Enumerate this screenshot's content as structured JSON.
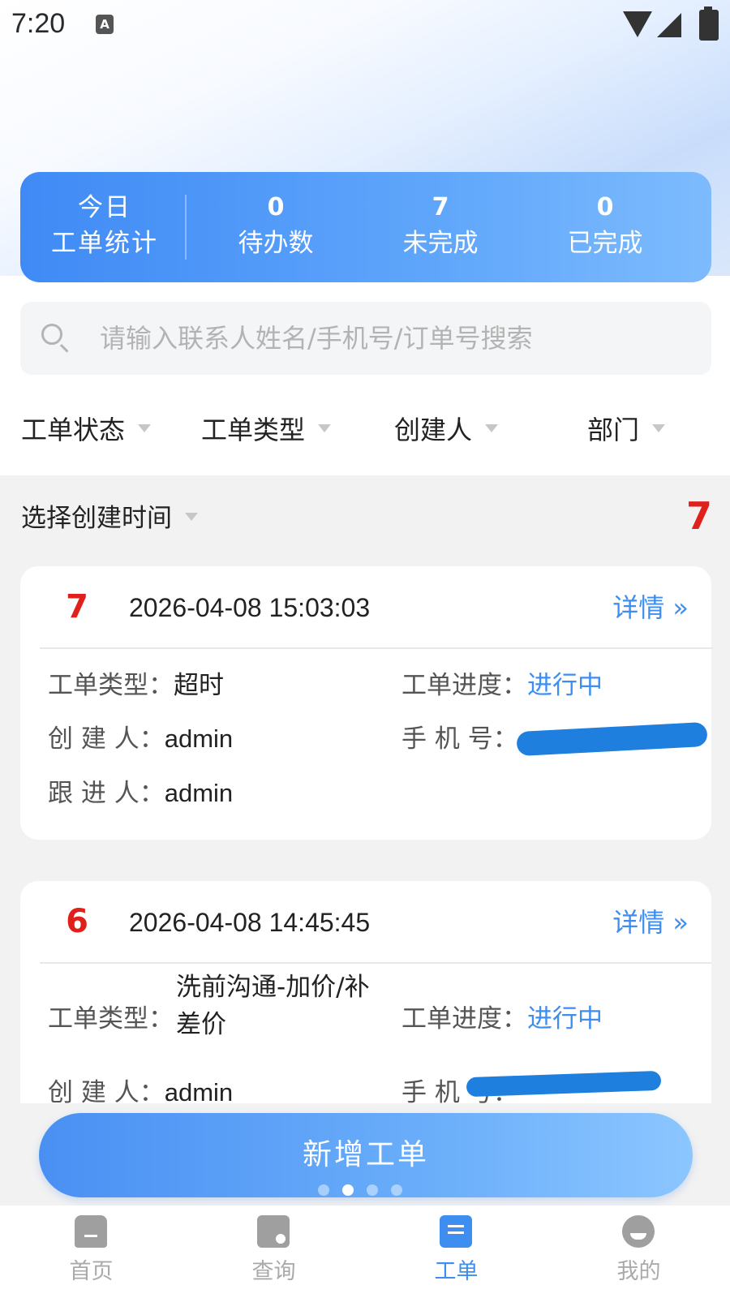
{
  "status_bar": {
    "time": "7:20",
    "notification_letter": "A"
  },
  "stats": {
    "title_line1": "今日",
    "title_line2": "工单统计",
    "items": [
      {
        "value": "0",
        "label": "待办数"
      },
      {
        "value": "7",
        "label": "未完成"
      },
      {
        "value": "0",
        "label": "已完成"
      }
    ]
  },
  "search": {
    "placeholder": "请输入联系人姓名/手机号/订单号搜索",
    "value": ""
  },
  "filters": [
    {
      "label": "工单状态"
    },
    {
      "label": "工单类型"
    },
    {
      "label": "创建人"
    },
    {
      "label": "部门"
    }
  ],
  "time_filter": {
    "label": "选择创建时间",
    "total": "7"
  },
  "orders": [
    {
      "index": "7",
      "created_at": "2026-04-08 15:03:03",
      "detail_label": "详情 »",
      "type_label": "工单类型：",
      "type_value": "超时",
      "progress_label": "工单进度：",
      "progress_value": "进行中",
      "creator_label": "创 建 人：",
      "creator_value": "admin",
      "phone_label": "手 机 号：",
      "follower_label": "跟 进 人：",
      "follower_value": "admin"
    },
    {
      "index": "6",
      "created_at": "2026-04-08 14:45:45",
      "detail_label": "详情 »",
      "type_label": "工单类型：",
      "type_value": "洗前沟通-加价/补差价",
      "progress_label": "工单进度：",
      "progress_value": "进行中",
      "creator_label": "创 建 人：",
      "creator_value": "admin",
      "phone_label": "手 机 号："
    }
  ],
  "new_order_button": "新增工单",
  "pager": {
    "count": 4,
    "active": 2
  },
  "tabs": [
    {
      "label": "首页",
      "icon": "home-icon"
    },
    {
      "label": "查询",
      "icon": "shirt-search-icon"
    },
    {
      "label": "工单",
      "icon": "order-icon"
    },
    {
      "label": "我的",
      "icon": "profile-icon"
    }
  ],
  "colors": {
    "accent": "#3d8ef0",
    "count_red": "#e0201b",
    "redaction": "#1f7fde"
  }
}
